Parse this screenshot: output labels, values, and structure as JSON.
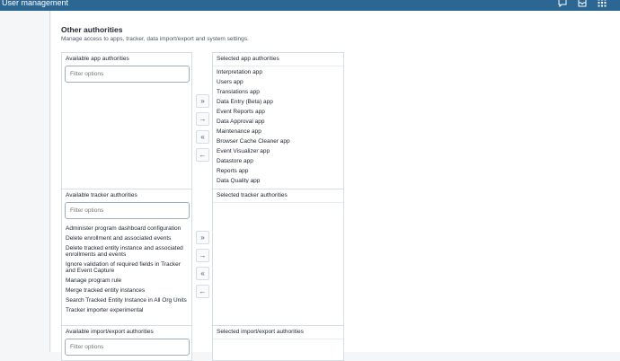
{
  "header": {
    "title": "User management"
  },
  "section": {
    "title": "Other authorities",
    "description": "Manage access to apps, tracker, data import/export and system settings."
  },
  "app": {
    "available_title": "Available app authorities",
    "selected_title": "Selected app authorities",
    "filter_placeholder": "Filter options",
    "selected_items": [
      "Interpretation app",
      "Users app",
      "Translations app",
      "Data Entry (Beta) app",
      "Event Reports app",
      "Data Approval app",
      "Maintenance app",
      "Browser Cache Cleaner app",
      "Event Visualizer app",
      "Datastore app",
      "Reports app",
      "Data Quality app"
    ]
  },
  "tracker": {
    "available_title": "Available tracker authorities",
    "selected_title": "Selected tracker authorities",
    "filter_placeholder": "Filter options",
    "available_items": [
      "Administer program dashboard configuration",
      "Delete enrollment and associated events",
      "Delete tracked entity instance and associated enrollments and events",
      "Ignore validation of required fields in Tracker and Event Capture",
      "Manage program rule",
      "Merge tracked entity instances",
      "Search Tracked Entity Instance in All Org Units",
      "Tracker importer experimental"
    ]
  },
  "import": {
    "available_title": "Available import/export authorities",
    "selected_title": "Selected import/export authorities",
    "filter_placeholder": "Filter options"
  },
  "buttons": {
    "select_all": "»",
    "select": "→",
    "deselect_all": "«",
    "deselect": "←"
  },
  "icons": [
    "chat-icon",
    "mail-icon",
    "apps-grid-icon"
  ]
}
